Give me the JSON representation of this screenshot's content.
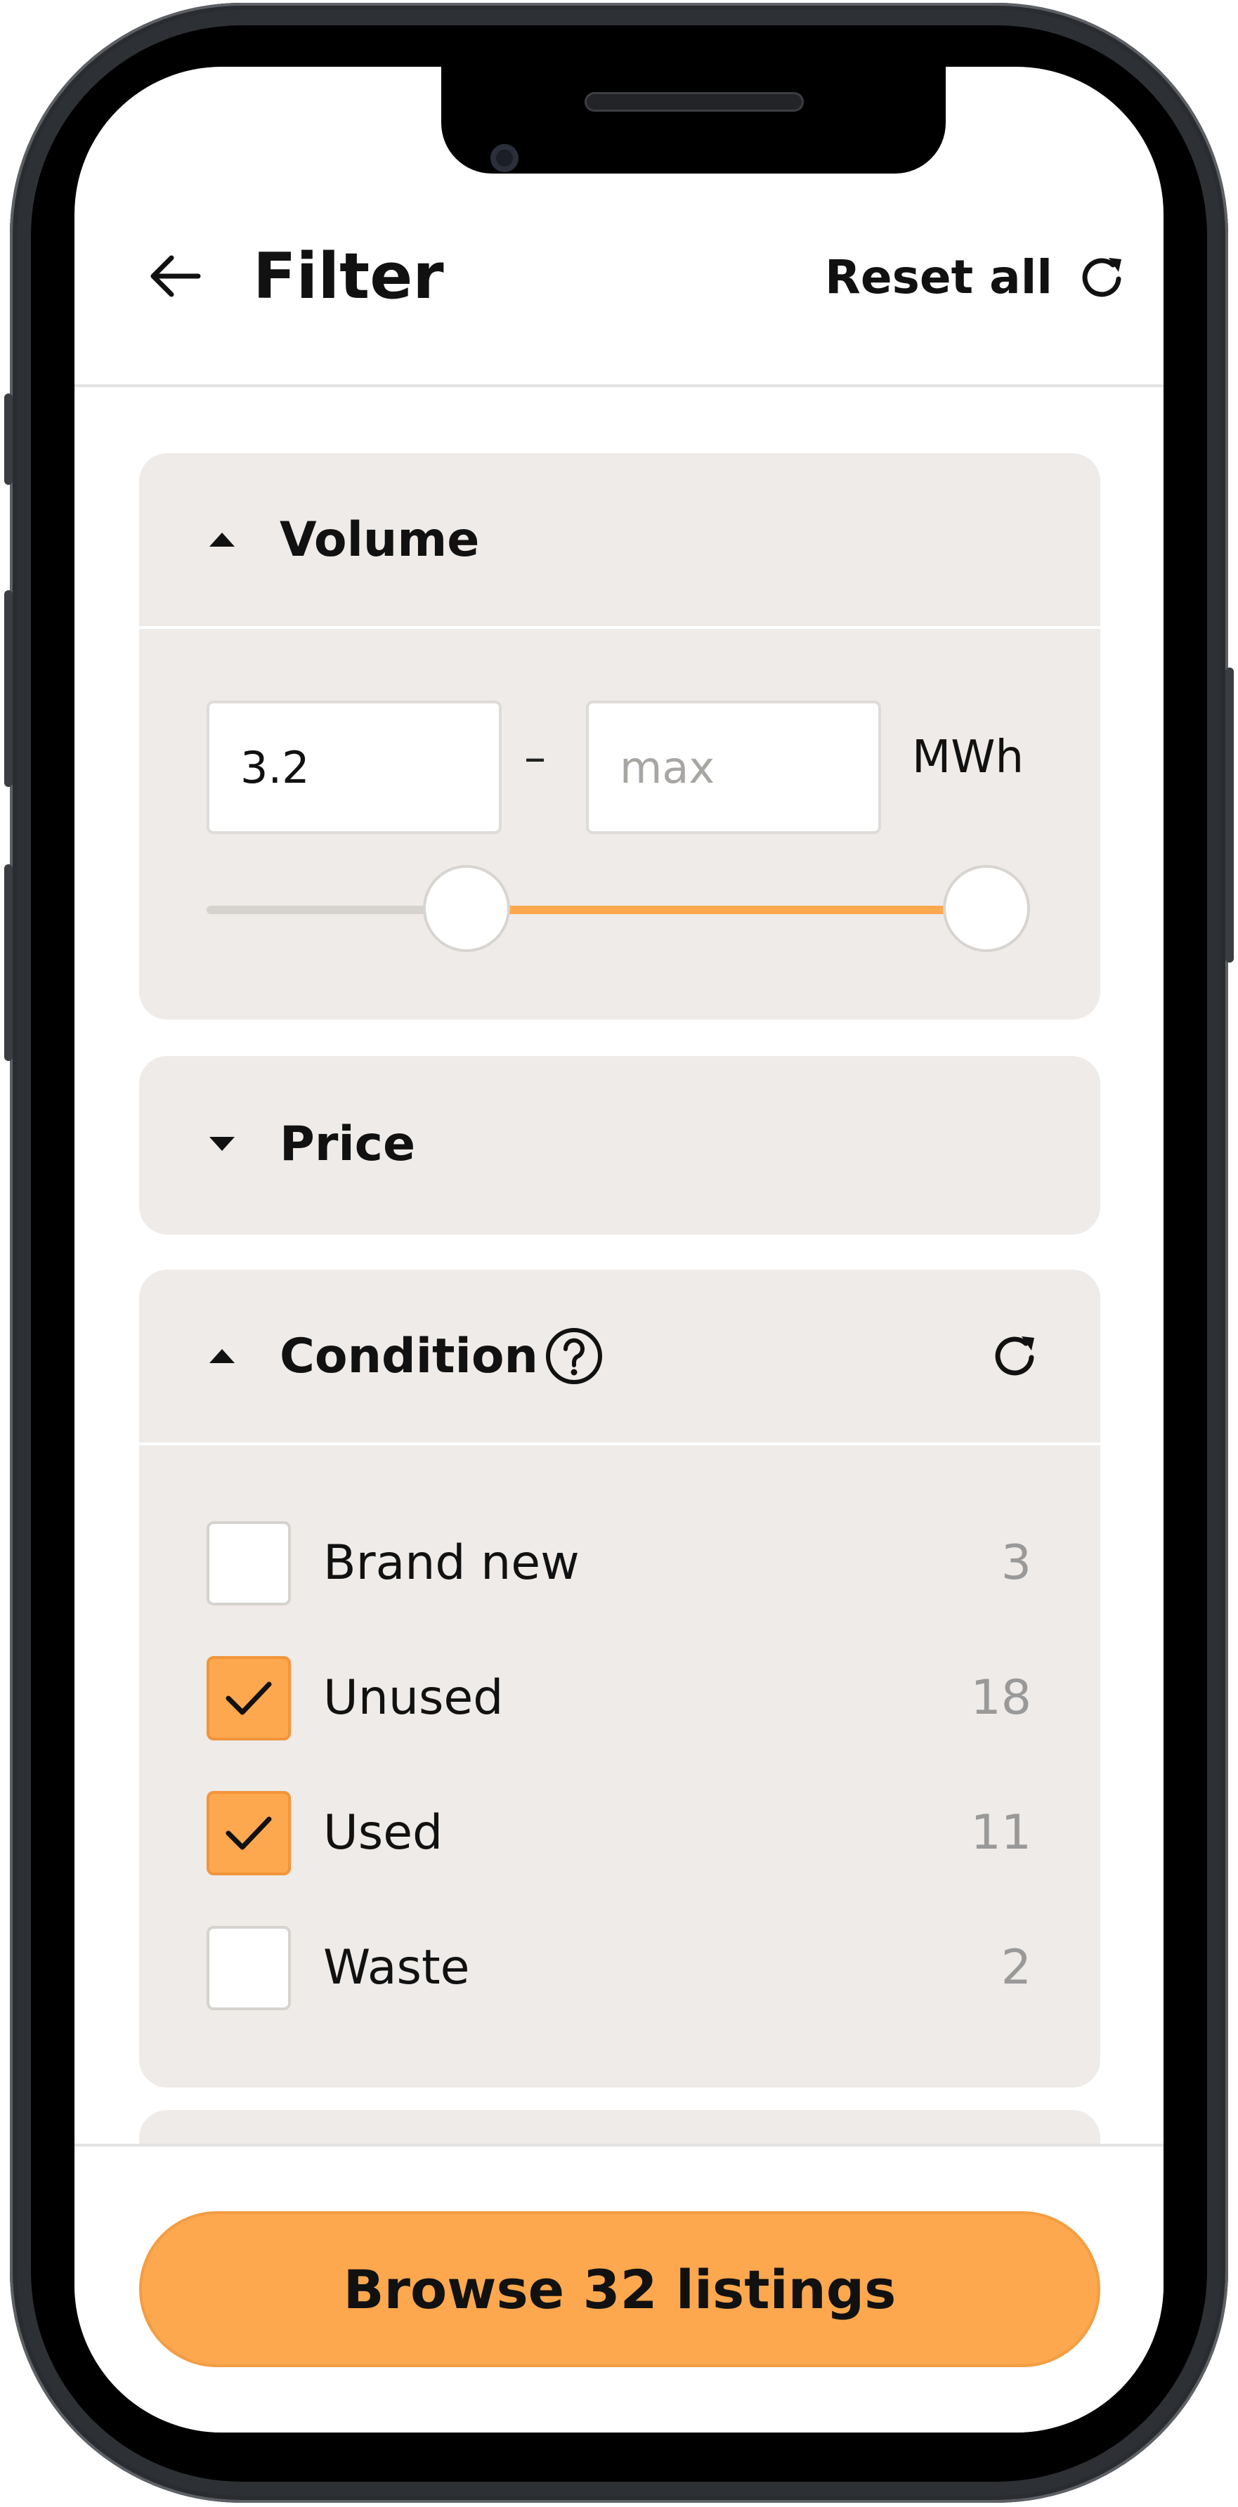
{
  "header": {
    "title": "Filter",
    "reset_all_label": "Reset all"
  },
  "volume": {
    "title": "Volume",
    "min_value": "3.2",
    "max_placeholder": "max",
    "separator": "–",
    "unit": "MWh",
    "expanded": true
  },
  "price": {
    "title": "Price",
    "expanded": false
  },
  "condition": {
    "title": "Condition",
    "expanded": true,
    "options": [
      {
        "label": "Brand new",
        "count": "3",
        "checked": false
      },
      {
        "label": "Unused",
        "count": "18",
        "checked": true
      },
      {
        "label": "Used",
        "count": "11",
        "checked": true
      },
      {
        "label": "Waste",
        "count": "2",
        "checked": false
      }
    ]
  },
  "footer": {
    "browse_label": "Browse 32 listings"
  },
  "colors": {
    "accent": "#fda84e",
    "card_bg": "#eeebe8",
    "text": "#111111",
    "muted": "#999999"
  }
}
